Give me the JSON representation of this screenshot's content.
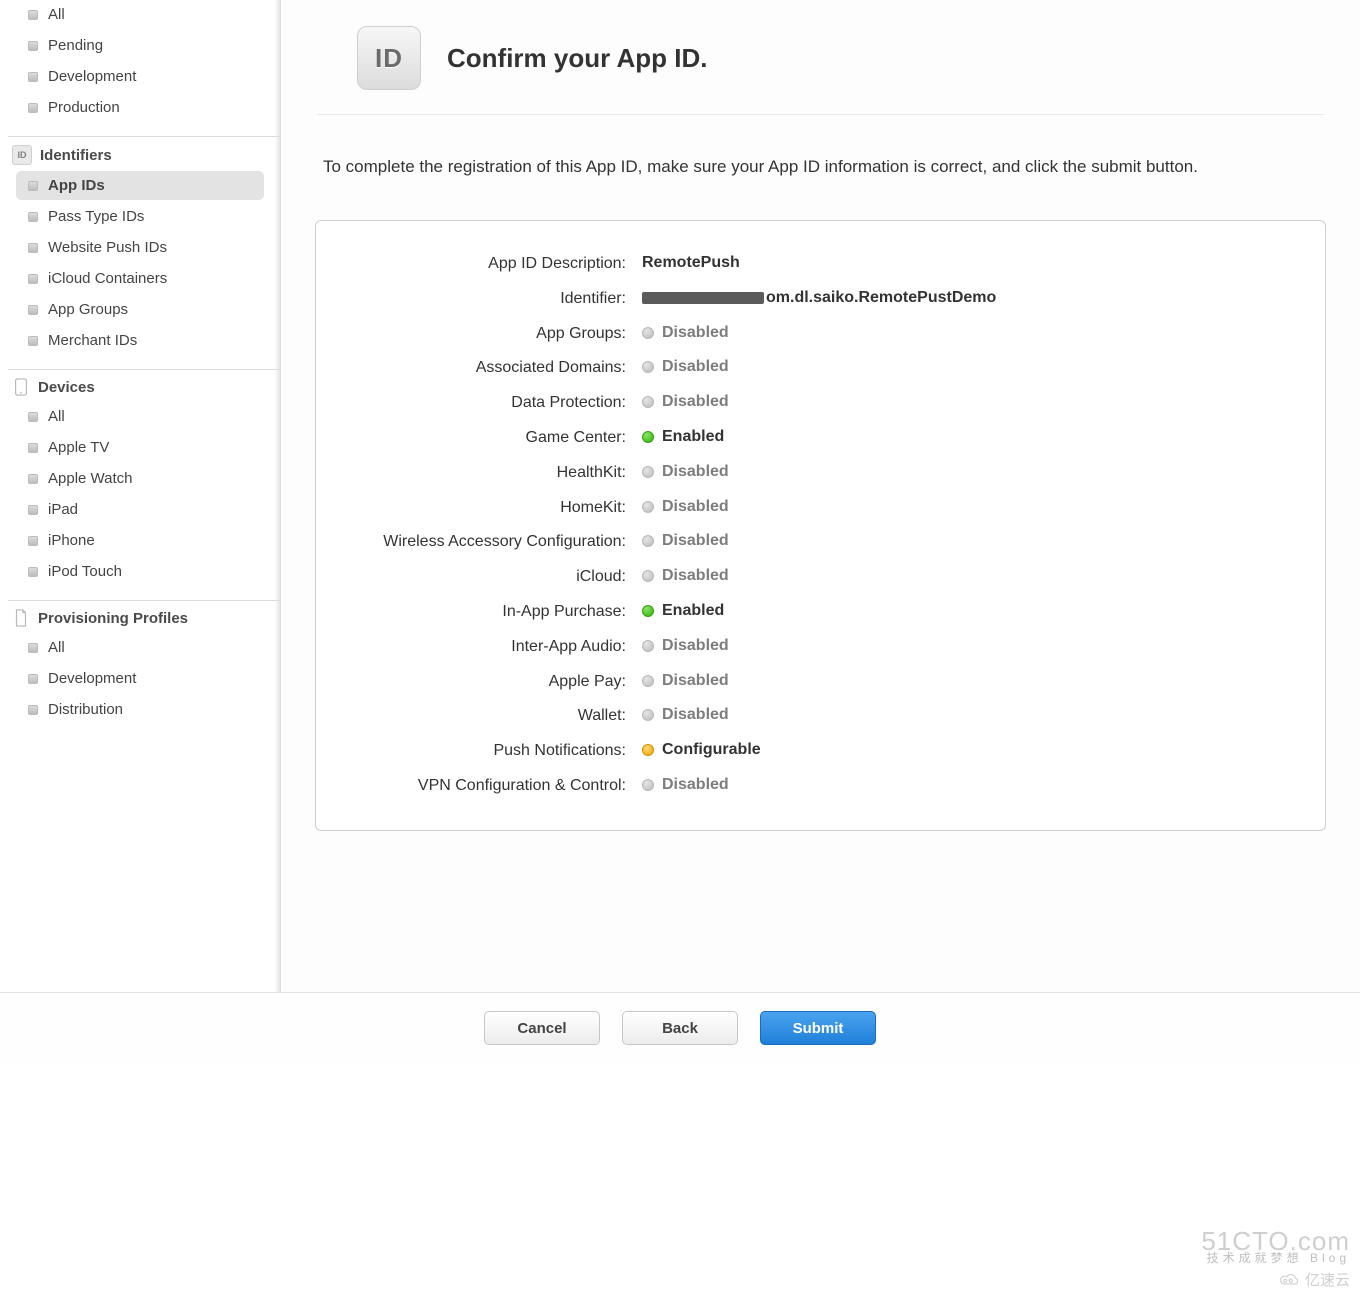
{
  "sidebar": {
    "certificates": {
      "items": [
        "All",
        "Pending",
        "Development",
        "Production"
      ]
    },
    "identifiers": {
      "title": "Identifiers",
      "items": [
        "App IDs",
        "Pass Type IDs",
        "Website Push IDs",
        "iCloud Containers",
        "App Groups",
        "Merchant IDs"
      ],
      "selected_index": 0
    },
    "devices": {
      "title": "Devices",
      "items": [
        "All",
        "Apple TV",
        "Apple Watch",
        "iPad",
        "iPhone",
        "iPod Touch"
      ]
    },
    "profiles": {
      "title": "Provisioning Profiles",
      "items": [
        "All",
        "Development",
        "Distribution"
      ]
    }
  },
  "header": {
    "badge": "ID",
    "title": "Confirm your App ID."
  },
  "instruction": "To complete the registration of this App ID, make sure your App ID information is correct, and click the submit button.",
  "summary": {
    "description_label": "App ID Description:",
    "description_value": "RemotePush",
    "identifier_label": "Identifier:",
    "identifier_suffix": "om.dl.saiko.RemotePustDemo",
    "services": [
      {
        "label": "App Groups:",
        "status": "Disabled",
        "kind": "grey"
      },
      {
        "label": "Associated Domains:",
        "status": "Disabled",
        "kind": "grey"
      },
      {
        "label": "Data Protection:",
        "status": "Disabled",
        "kind": "grey"
      },
      {
        "label": "Game Center:",
        "status": "Enabled",
        "kind": "green"
      },
      {
        "label": "HealthKit:",
        "status": "Disabled",
        "kind": "grey"
      },
      {
        "label": "HomeKit:",
        "status": "Disabled",
        "kind": "grey"
      },
      {
        "label": "Wireless Accessory Configuration:",
        "status": "Disabled",
        "kind": "grey"
      },
      {
        "label": "iCloud:",
        "status": "Disabled",
        "kind": "grey"
      },
      {
        "label": "In-App Purchase:",
        "status": "Enabled",
        "kind": "green"
      },
      {
        "label": "Inter-App Audio:",
        "status": "Disabled",
        "kind": "grey"
      },
      {
        "label": "Apple Pay:",
        "status": "Disabled",
        "kind": "grey"
      },
      {
        "label": "Wallet:",
        "status": "Disabled",
        "kind": "grey"
      },
      {
        "label": "Push Notifications:",
        "status": "Configurable",
        "kind": "amber"
      },
      {
        "label": "VPN Configuration & Control:",
        "status": "Disabled",
        "kind": "grey"
      }
    ]
  },
  "footer": {
    "cancel": "Cancel",
    "back": "Back",
    "submit": "Submit"
  },
  "watermark": {
    "main": "51CTO.com",
    "sub": "技术成就梦想  Blog",
    "secondary": "亿速云"
  }
}
